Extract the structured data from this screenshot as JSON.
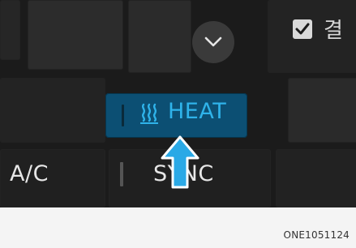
{
  "panel": {
    "heat_button": {
      "label": "HEAT",
      "icon": "heated-seat-icon",
      "color": "#2fb3ea",
      "background": "#0c4f73"
    },
    "ac_button": {
      "label": "A/C"
    },
    "sync_button": {
      "label": "SYNC"
    },
    "checkbox": {
      "label": "결",
      "checked": true
    },
    "expand": {
      "icon": "chevron-down-icon"
    },
    "pointer": {
      "icon": "up-arrow-icon"
    }
  },
  "footer": {
    "code": "ONE1051124"
  }
}
